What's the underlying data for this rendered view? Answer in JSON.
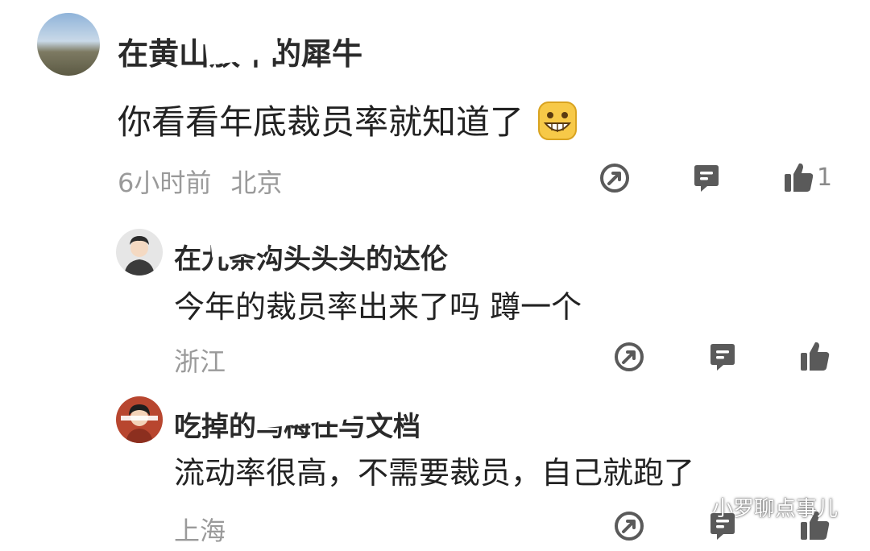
{
  "comments": [
    {
      "username": "在黄山放牛的犀牛",
      "text": "你看看年底裁员率就知道了",
      "time": "6小时前",
      "location": "北京",
      "likes": "1",
      "emoji": "grin-emoji"
    },
    {
      "username": "在九条沟头头头的达伦",
      "text": "今年的裁员率出来了吗 蹲一个",
      "location": "浙江"
    },
    {
      "username": "吃掉的乌梅任与文档",
      "text": "流动率很高，不需要裁员，自己就跑了",
      "location": "上海"
    }
  ],
  "watermark": "小罗聊点事儿",
  "colors": {
    "icon": "#5a5a5a",
    "meta": "#9a9a9a",
    "text": "#222222"
  }
}
